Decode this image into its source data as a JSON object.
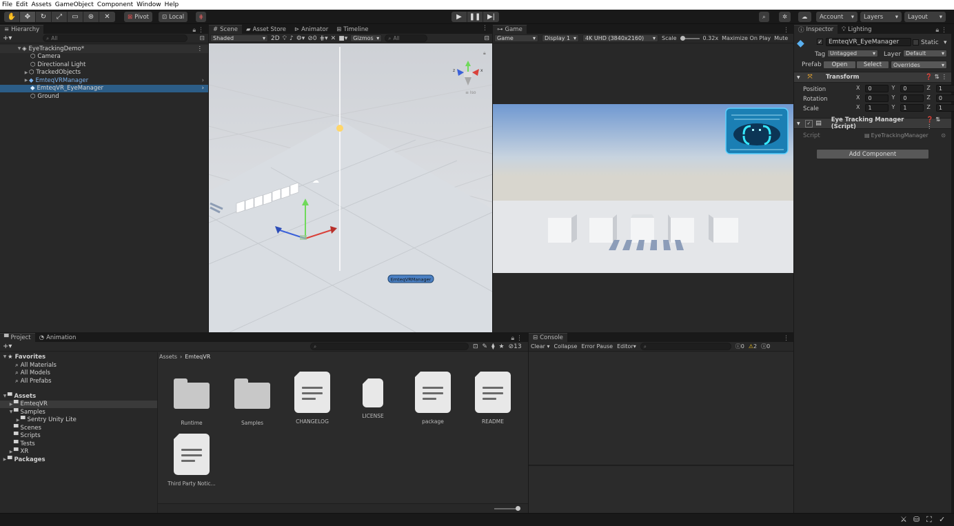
{
  "menu": [
    "File",
    "Edit",
    "Assets",
    "GameObject",
    "Component",
    "Window",
    "Help"
  ],
  "toolbar": {
    "pivot": "Pivot",
    "local": "Local",
    "account": "Account",
    "layers": "Layers",
    "layout": "Layout"
  },
  "hierarchy": {
    "tab": "Hierarchy",
    "search_placeholder": "All",
    "scene": "EyeTrackingDemo*",
    "items": [
      "Camera",
      "Directional Light",
      "TrackedObjects",
      "EmteqVRManager",
      "EmteqVR_EyeManager",
      "Ground"
    ]
  },
  "scene": {
    "tabs": [
      "Scene",
      "Asset Store",
      "Animator",
      "Timeline"
    ],
    "shading": "Shaded",
    "mode_2d": "2D",
    "hidden_count": "0",
    "gizmos": "Gizmos",
    "search_placeholder": "All",
    "persp": "≡ Iso",
    "label_tag": "EmteqVRManager"
  },
  "game": {
    "tab": "Game",
    "mode": "Game",
    "display": "Display 1",
    "resolution": "4K UHD (3840x2160)",
    "scale_label": "Scale",
    "scale_value": "0.32x",
    "maximize": "Maximize On Play",
    "mute": "Mute"
  },
  "inspector": {
    "tabs": [
      "Inspector",
      "Lighting"
    ],
    "object_name": "EmteqVR_EyeManager",
    "static_label": "Static",
    "tag_label": "Tag",
    "tag_value": "Untagged",
    "layer_label": "Layer",
    "layer_value": "Default",
    "prefab_label": "Prefab",
    "open": "Open",
    "select": "Select",
    "overrides": "Overrides",
    "transform_title": "Transform",
    "position_label": "Position",
    "rotation_label": "Rotation",
    "scale_label": "Scale",
    "position": {
      "x": "0",
      "y": "0",
      "z": "1"
    },
    "rotation": {
      "x": "0",
      "y": "0",
      "z": "0"
    },
    "scale": {
      "x": "1",
      "y": "1",
      "z": "1"
    },
    "script_component_title": "Eye Tracking Manager (Script)",
    "script_label": "Script",
    "script_value": "EyeTrackingManager",
    "add_component": "Add Component"
  },
  "project": {
    "tabs": [
      "Project",
      "Animation"
    ],
    "hidden_count": "13",
    "favorites_label": "Favorites",
    "favorites": [
      "All Materials",
      "All Models",
      "All Prefabs"
    ],
    "assets_label": "Assets",
    "tree": [
      "EmteqVR",
      "Samples",
      "Sentry Unity Lite",
      "Scenes",
      "Scripts",
      "Tests",
      "XR"
    ],
    "packages_label": "Packages",
    "breadcrumb_root": "Assets",
    "breadcrumb_current": "EmteqVR",
    "files": [
      "Runtime",
      "Samples",
      "CHANGELOG",
      "LICENSE",
      "package",
      "README",
      "Third Party Notic..."
    ]
  },
  "console": {
    "tab": "Console",
    "clear": "Clear",
    "collapse": "Collapse",
    "error_pause": "Error Pause",
    "editor": "Editor",
    "info_count": "0",
    "warning_count": "2",
    "error_count": "0"
  },
  "colors": {
    "selection": "#2c5d87",
    "prefab_blue": "#7cb4f0",
    "accent_cyan": "#1fb8e8"
  }
}
